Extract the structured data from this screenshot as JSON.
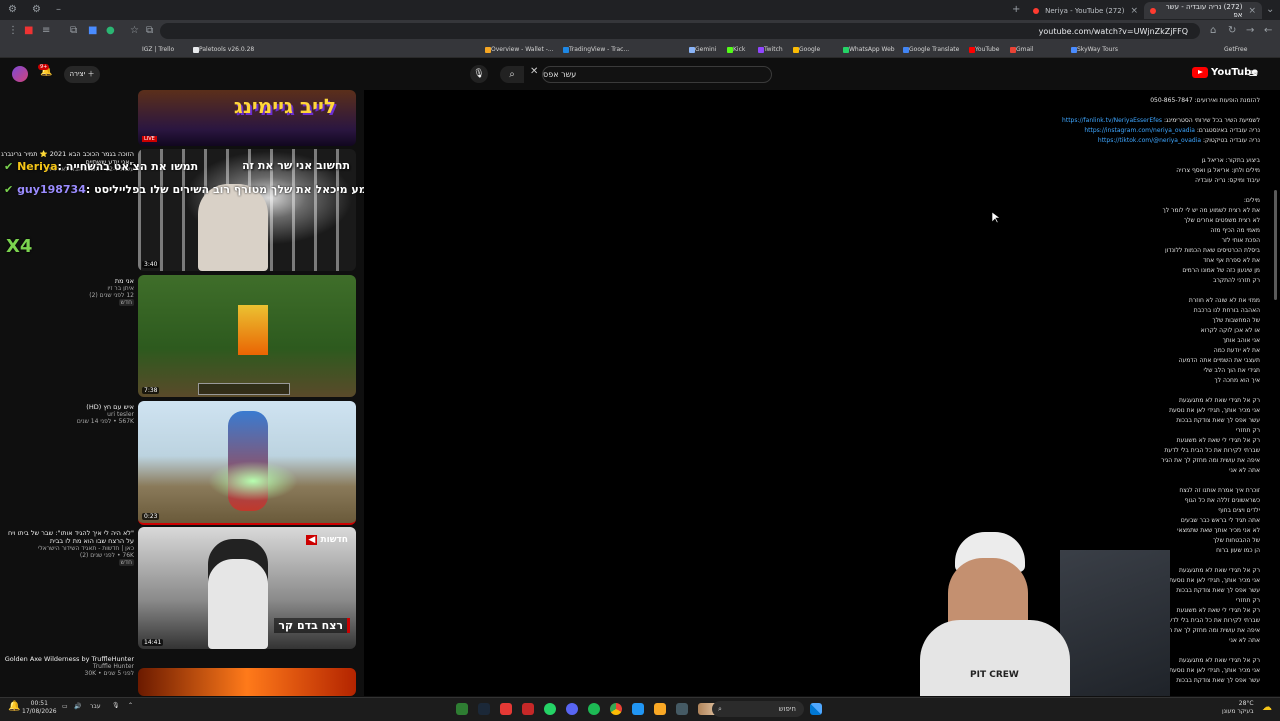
{
  "browser": {
    "tabs": [
      {
        "label": "(272) Neriya - YouTube",
        "active": false
      },
      {
        "label": "(272) נריה עובדיה - עשר אפ",
        "active": true
      }
    ],
    "url": "youtube.com/watch?v=UWjnZkZjFFQ",
    "bookmarks": [
      "GetFree",
      "YouTube",
      "Gmail",
      "SkyWay Tours",
      "Google Translate",
      "WhatsApp Web",
      "Google",
      "Twitch",
      "Kick",
      "Gemini",
      "TradingView - Trac...",
      "Overview - Wallet -...",
      "Paletools v26.0.28",
      "IGZ | Trello"
    ]
  },
  "youtube": {
    "logo_text": "YouTube",
    "search_value": "עשר אפס",
    "create_label": "יצירה",
    "notif_count": "9+"
  },
  "related": [
    {
      "title": "",
      "channel": "",
      "meta": "",
      "duration": "",
      "overlay": "לייב גיימינג",
      "badge": "LIVE"
    },
    {
      "title": "הזוכה בגמר הכוכב הבא 2021 ⭐ תמיר גרינברג - אני יודע ששתיים",
      "channel": "עשות ל-12 - הכוכב הבא לאירוויזיון",
      "meta": "",
      "duration": "3:40",
      "overlay": "תחשוב אני שר את זה",
      "badge": ""
    },
    {
      "title": "אני מת",
      "channel": "איתן בר זיו",
      "meta": "12 לפני שנים (2)",
      "duration": "7:38",
      "overlay": "",
      "badge": "חדש"
    },
    {
      "title": "איש עם חץ (HD)",
      "channel": "uri tesler",
      "meta": "567K • לפני 14 שנים",
      "duration": "0:23",
      "overlay": "",
      "badge": ""
    },
    {
      "title": "\"לא היה לי איך להגיד אותו\": שבר של ביתו ויח על הרצח שבו הוא מת לו בבית",
      "channel": "כאן | חדשות - תאגיד השידור הישראלי",
      "meta": "76K • לפני שנים (2)",
      "duration": "14:41",
      "overlay": "רצח בדם קר",
      "badge": "חדש"
    },
    {
      "title": "Golden Axe  Wilderness by TruffleHunter",
      "channel": "Truffle Hunter",
      "meta": "30K • לפני 5 שנים",
      "duration": "",
      "overlay": "",
      "badge": ""
    }
  ],
  "chat": [
    {
      "user": "Neriya",
      "text": ": תמשו את הצ'אט בהשחייה",
      "color": "#f5c518"
    },
    {
      "user": "guy198734",
      "text": ": שמע מיכאל את שלך מטורף רוב השירים שלו בפלייליסט",
      "color": "#9b8cff"
    },
    {
      "user": "X4",
      "text": "",
      "color": "#7bd34f"
    }
  ],
  "overlay_text": "חדשות",
  "description": {
    "contact": "להזמנת הופעות ואירועים: 050-865-7847",
    "links_intro": "לשמיעת השיר בכל שירותי הסטרימינג:",
    "links": [
      {
        "label": "https://fanlink.tv/NeriyaEsserEfes",
        "prefix": ""
      },
      {
        "label": "https://instagram.com/neriya_ovadia",
        "prefix": "נריה עובדיה באינסטגרם:"
      },
      {
        "label": "https://tiktok.com/@neriya_ovadia",
        "prefix": "נריה עובדיה בטיקטוק:"
      }
    ],
    "credits": [
      "ביצוע בתקור: אריאל גן",
      "מילים ולחן: אריאל גן ואסף צרויה",
      "עיבוד ומיקס: נריה עובדיה"
    ],
    "lyrics_heading": "מילים:",
    "lyrics": [
      "את לא רצית לשמוע מה יש לי לומר לך",
      "לא רצית משפטים אחרים שלך",
      "מאמי מה הכיף מזה",
      "הפכת אותי לזר",
      "ביסלת הכרטיסים שאת הכמות ללונדון",
      "את לא ספרת אף אחד",
      "מן שיגעון כזה של אמונו הרמים",
      "רק תזרני להתקרב",
      "",
      "ממזי את לא שונה לא חוזרת",
      "האהבה בורחת לנו ברכבת",
      "של המחשבות שלך",
      "או לא אכן לוקה לקרוא",
      "אני אוהב אותך",
      "את לא יודעת כמה",
      "תעצבי את השמיים אתה הדמעה",
      "תגידי את הוך הלב שלי",
      "איך הוא מחכה לך",
      "",
      "רק אל תגידי שאת לא מתגעגעת",
      "אני מכיר אותך, תגידי לאן את נוסעת",
      "עשר אפס לך שאת צודקת בבכות",
      "רק תחזרי",
      "רק אל תגידי לי שאת לא משוגעת",
      "שברתי לקירות את כל הבית בלי לדעת",
      "איפה את עושית ומה מחזק לך את הגיר",
      "אתה לא אני",
      "",
      "זוכרת איך אמרת אותנו זה לנצח",
      "כשראשונים זללה את כל הגוף",
      "ילדים ויצים בחוף",
      "אתה תגיד לי בראש כבר שבעים",
      "לא אני מכיר אותך שאת שתמצאי",
      "של ההבטחות שלך",
      "הן כמו שעון ברוח",
      "",
      "רק אל תגידי שאת לא מתגעגעת",
      "אני מכיר אותך, תגידי לאן את נוסעת",
      "עשר אפס לך שאת צודקת בבכות",
      "רק תחזרי",
      "רק אל תגידי לי שאת לא משוגעת",
      "שברתי לקירות את כל הבית בלי לדעת",
      "איפה את עושית ומה מחזק לך את הגיר",
      "אתה לא אני",
      "",
      "רק אל תגידי שאת לא מתגעגעת",
      "אני מכיר אותך, תגידי לאן את נוסעת",
      "עשר אפס לך שאת צודקת בבכות"
    ]
  },
  "taskbar": {
    "time": "00:51",
    "date": "17/08/2026",
    "search_placeholder": "חיפוש",
    "weather": "28°C",
    "weather_note": "בעיקר מעונן",
    "lang": "עבר"
  }
}
